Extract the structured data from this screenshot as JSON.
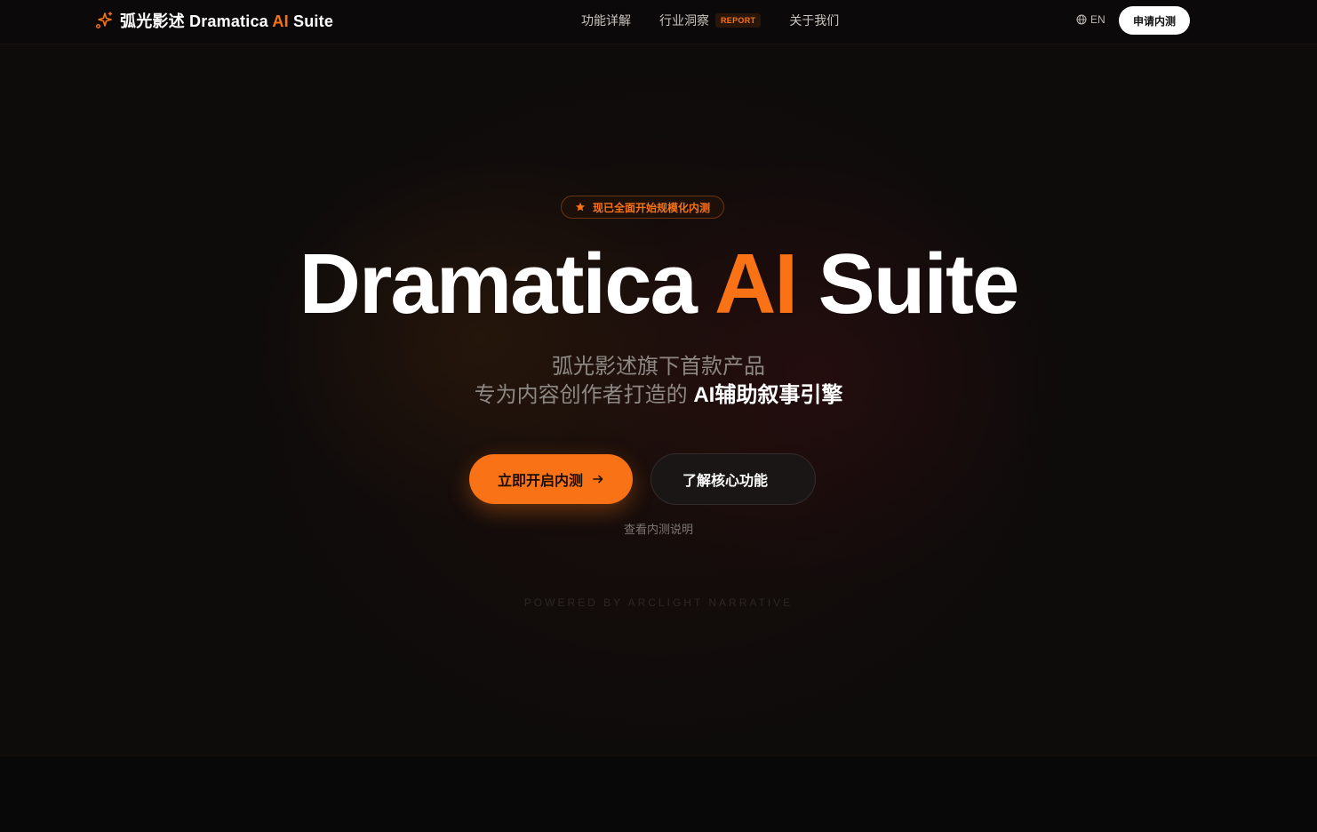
{
  "navbar": {
    "brand_cn": "弧光影述",
    "brand_name": "Dramatica",
    "brand_accent": "AI",
    "brand_suffix": "Suite",
    "brand_icon": "sparkles-icon",
    "links": [
      {
        "label": "功能详解"
      },
      {
        "label": "行业洞察",
        "tag": "REPORT"
      },
      {
        "label": "关于我们"
      }
    ],
    "language": {
      "icon": "globe-icon",
      "label": "EN"
    },
    "apply_label": "申请内测"
  },
  "hero": {
    "badge": {
      "icon": "star-icon",
      "label": "现已全面开始规模化内测"
    },
    "title": {
      "part1": "Dramatica",
      "accent": "AI",
      "part2": "Suite"
    },
    "subtitle_line1": "弧光影述旗下首款产品",
    "subtitle_line2_prefix": "专为内容创作者打造的",
    "subtitle_line2_strong": "AI辅助叙事引擎",
    "primary_cta": {
      "label": "立即开启内测",
      "icon": "arrow-right-icon"
    },
    "secondary_cta": {
      "label": "了解核心功能"
    },
    "explain_link": "查看内测说明",
    "powered_by": "POWERED BY ARCLIGHT NARRATIVE"
  },
  "colors": {
    "accent": "#f97316",
    "background": "#0e0b0b",
    "text": "#ffffff",
    "muted_text": "#8e8884"
  }
}
